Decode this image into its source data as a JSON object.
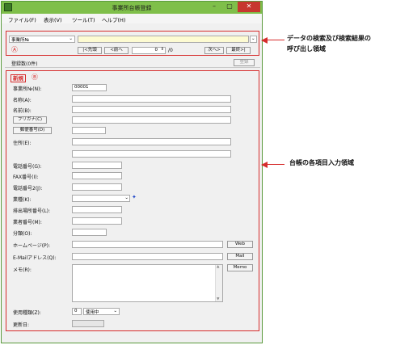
{
  "window": {
    "title": "事業所台帳登録",
    "min_glyph": "–",
    "max_glyph": "▢",
    "close_glyph": "✕"
  },
  "menu": [
    "ファイル(F)",
    "表示(V)",
    "ツール(T)",
    "ヘルプ(H)"
  ],
  "search": {
    "field_select": "事業所№",
    "first_button": "|<先頭",
    "prev_button": "<前へ",
    "page_value": "0",
    "page_total": "/0",
    "next_button": "次へ>",
    "last_button": "最終>|",
    "circle_label": "Ⓐ"
  },
  "record_count": "登録数(0件)",
  "register_button": "登録",
  "form": {
    "new_label": "新規",
    "circle_label": "Ⓑ",
    "office_no_label": "事業所№(N):",
    "office_no_value": "00001",
    "name_label": "名称(A):",
    "name2_label": "名前(B):",
    "furigana_button": "フリガナ(C)",
    "postal_button": "郵便番号(D)",
    "address_label": "住所(E):",
    "phone_label": "電話番号(G):",
    "fax_label": "FAX番号(I):",
    "phone2_label": "電話番号2(J):",
    "industry_label": "業種(K):",
    "discharge_label": "排出場所番号(L):",
    "business_label": "業者番号(M):",
    "category_label": "分類(O):",
    "homepage_label": "ホームページ(P):",
    "web_button": "Web",
    "email_label": "E-Mailアドレス(Q):",
    "mail_button": "Mail",
    "memo_label": "メモ(R):",
    "memo_button": "Memo",
    "usage_label": "使用種類(Z):",
    "usage_value": "0",
    "usage_select": "使用中",
    "updated_label": "更新日:"
  },
  "annotations": {
    "search_area": [
      "データの検索及び検索結果の",
      "呼び出し領域"
    ],
    "input_area": "台帳の各項目入力領域"
  },
  "colors": {
    "titlebar": "#7fbf4a",
    "highlight": "#d62c2c",
    "search_field": "#fdfbd2"
  }
}
